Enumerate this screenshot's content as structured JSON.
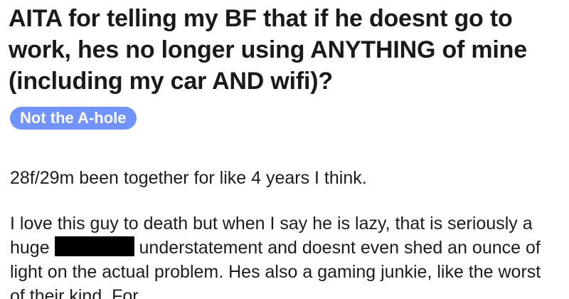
{
  "post": {
    "title": "AITA for telling my BF that if he doesnt go to work, hes no longer using ANYTHING of mine (including my car AND wifi)?",
    "flair": "Not the A-hole",
    "flair_color": "#7193ff",
    "paragraph1": "28f/29m been together for like 4 years I think.",
    "paragraph2_before": "I love this guy to death but when I say he is lazy, that is seriously a huge",
    "paragraph2_after": "understatement and doesnt even shed an ounce of light on the actual problem. Hes also a gaming junkie, like the worst of their kind. For"
  }
}
